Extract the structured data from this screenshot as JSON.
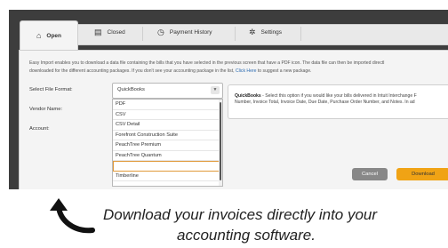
{
  "tabs": [
    {
      "label": "Open",
      "icon": "home-icon"
    },
    {
      "label": "Closed",
      "icon": "table-icon"
    },
    {
      "label": "Payment History",
      "icon": "history-icon"
    },
    {
      "label": "Settings",
      "icon": "gear-icon"
    }
  ],
  "intro": {
    "line1": "Easy Import enables you to download a data file containing the bills that you have selected in the previous screen that have a PDF icon. The data file can then be imported directl",
    "line2_pre": "downloaded for the different accounting packages. If you don't see your accounting package in the list, ",
    "link": "Click Here",
    "line2_post": " to suggest a new package."
  },
  "form": {
    "file_format_label": "Select File Format:",
    "vendor_name_label": "Vendor Name:",
    "account_label": "Account:",
    "selected_format": "QuickBooks"
  },
  "dropdown": {
    "options": [
      "PDF",
      "CSV",
      "CSV Detail",
      "Forefront Construction Suite",
      "PeachTree Premium",
      "PeachTree Quantum",
      "",
      "Timberline"
    ]
  },
  "description": {
    "title": "QuickBooks",
    "line1": " - Select this option if you would like your bills delivered in Intuit Interchange F",
    "line2": "Number, Invoice Total, Invoice Date, Due Date, Purchase Order Number, and Notes. In ad"
  },
  "buttons": {
    "cancel": "Cancel",
    "download": "Download"
  },
  "caption": {
    "line1": "Download your invoices directly into your",
    "line2": "accounting software."
  },
  "colors": {
    "accent": "#f0a315",
    "link": "#2a6ab0",
    "frame": "#3d3d3d"
  }
}
